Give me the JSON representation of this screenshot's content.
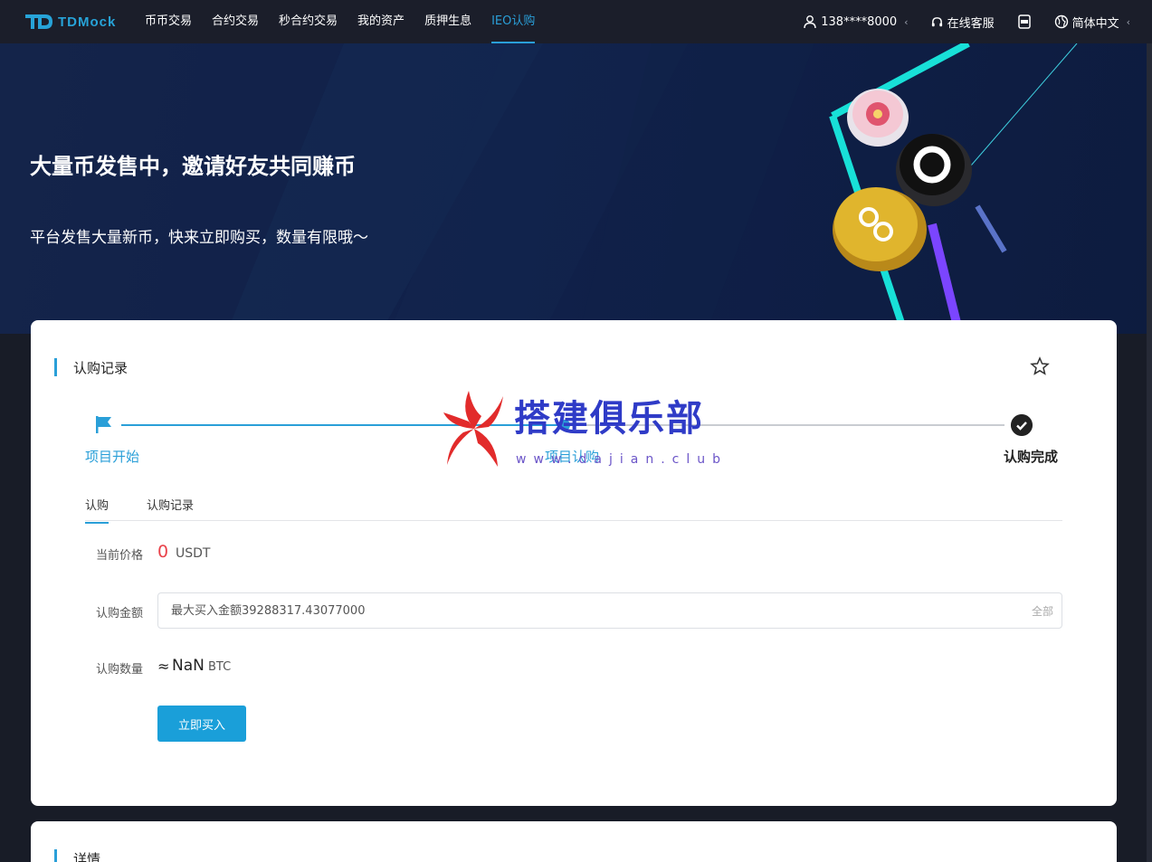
{
  "nav": {
    "logo_text": "TDMock",
    "menu": [
      {
        "label": "币币交易"
      },
      {
        "label": "合约交易"
      },
      {
        "label": "秒合约交易"
      },
      {
        "label": "我的资产"
      },
      {
        "label": "质押生息"
      },
      {
        "label": "IEO认购"
      }
    ],
    "active_menu": "IEO认购",
    "account": "138****8000",
    "service": "在线客服",
    "language": "简体中文",
    "icons": [
      "user-icon",
      "headset-icon",
      "app-download-icon",
      "globe-icon"
    ]
  },
  "hero": {
    "title": "大量币发售中，邀请好友共同赚币",
    "subtitle": "平台发售大量新币，快来立即购买，数量有限哦～"
  },
  "record": {
    "section_title": "认购记录",
    "steps": [
      {
        "label": "项目开始"
      },
      {
        "label": "项目认购"
      },
      {
        "label": "认购完成"
      }
    ],
    "tabs": [
      {
        "label": "认购"
      },
      {
        "label": "认购记录"
      }
    ],
    "form": {
      "price_label": "当前价格",
      "price_value": "0",
      "price_unit": "USDT",
      "amount_label": "认购金额",
      "amount_placeholder": "最大买入金额39288317.43077000",
      "all_label": "全部",
      "qty_label": "认购数量",
      "qty_approx": "≈",
      "qty_value": "NaN",
      "qty_unit": "BTC",
      "buy_label": "立即买入"
    }
  },
  "details": {
    "section_title": "详情"
  },
  "watermark": {
    "text": "搭建俱乐部",
    "url": "www.dajian.club"
  },
  "colors": {
    "accent": "#2a9fd8",
    "nav_bg": "#1b1e2a",
    "price_red": "#e9424a",
    "button": "#1a9fd9"
  }
}
